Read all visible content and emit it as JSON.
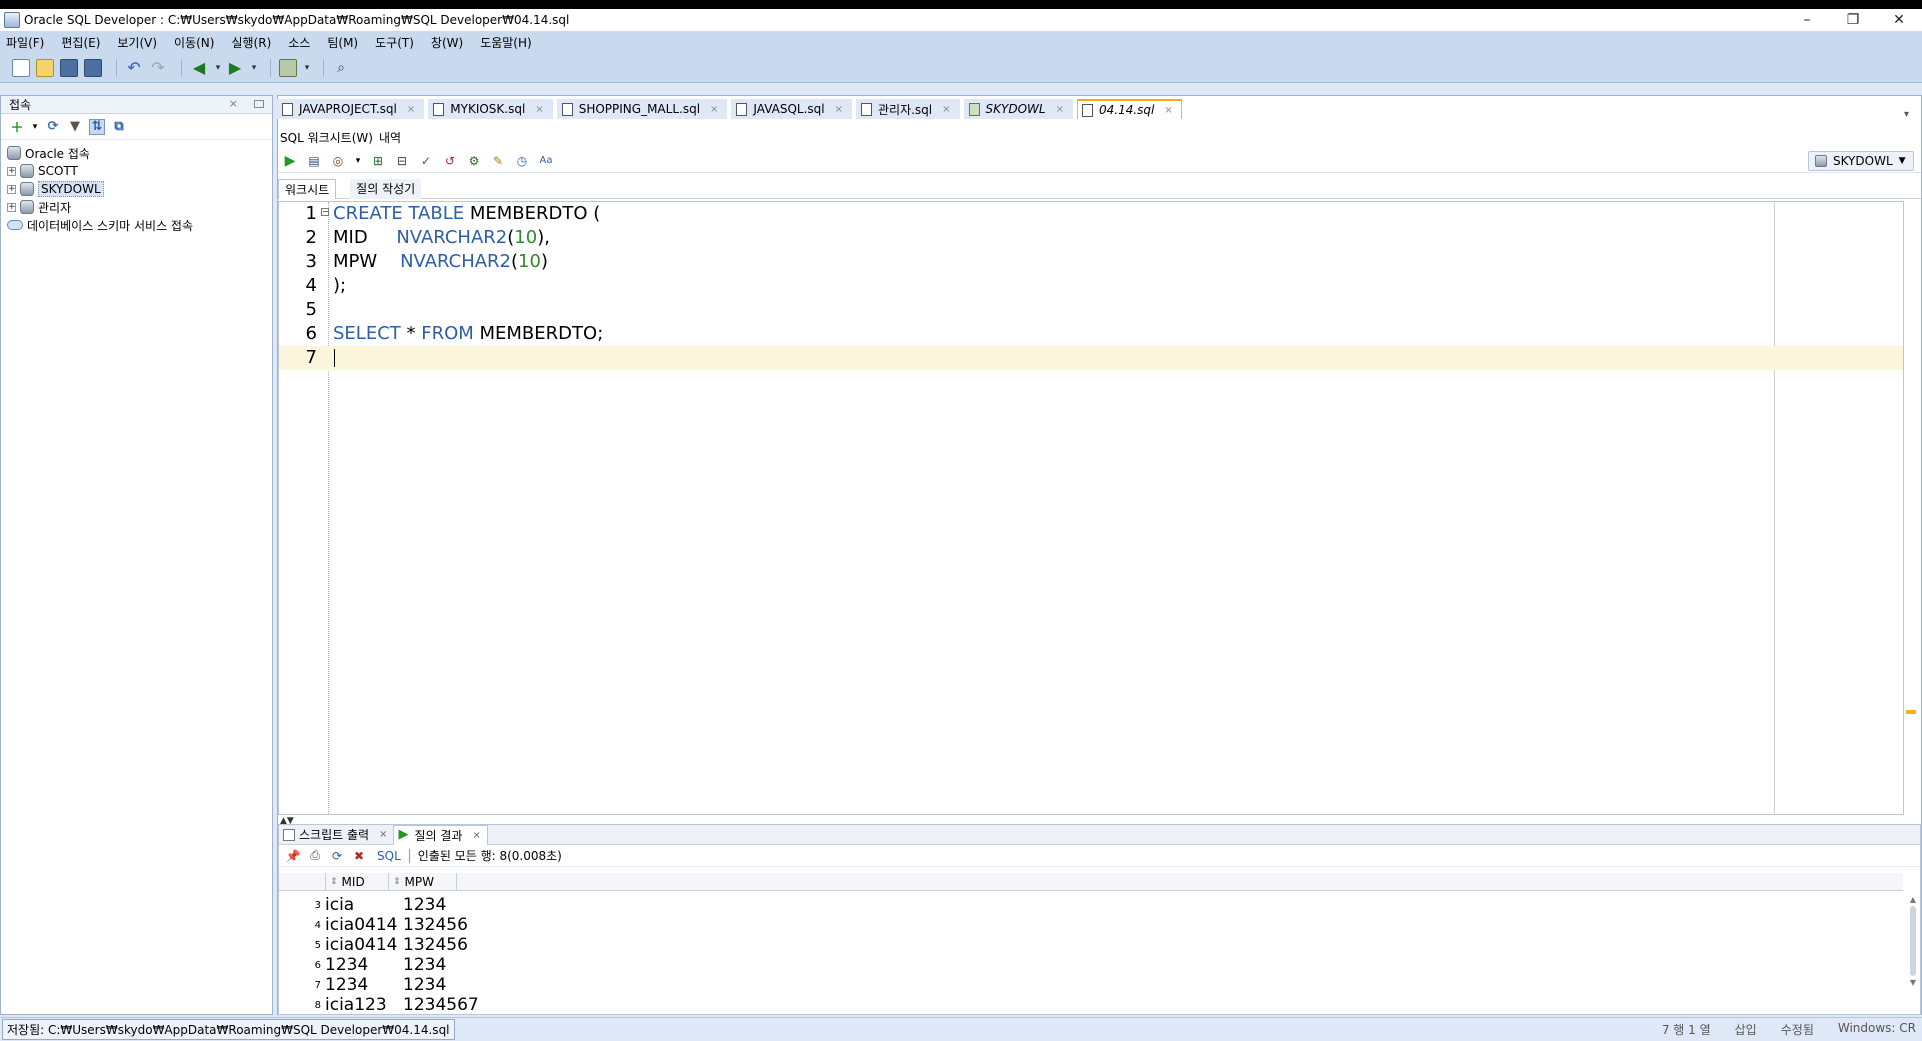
{
  "window": {
    "title": "Oracle SQL Developer : C:₩Users₩skydo₩AppData₩Roaming₩SQL Developer₩04.14.sql",
    "minimize": "–",
    "restore": "❐",
    "close": "✕"
  },
  "menu": [
    "파일(F)",
    "편집(E)",
    "보기(V)",
    "이동(N)",
    "실행(R)",
    "소스",
    "팀(M)",
    "도구(T)",
    "창(W)",
    "도움말(H)"
  ],
  "connections_panel": {
    "title": "접속",
    "close": "×",
    "tree": [
      {
        "label": "Oracle 접속",
        "level": 0,
        "icon": "database-icon"
      },
      {
        "label": "SCOTT",
        "level": 1,
        "icon": "database-icon",
        "expander": "+"
      },
      {
        "label": "SKYDOWL",
        "level": 1,
        "icon": "database-icon",
        "expander": "+",
        "selected": true
      },
      {
        "label": "관리자",
        "level": 1,
        "icon": "database-icon",
        "expander": "+"
      },
      {
        "label": "데이터베이스 스키마 서비스 접속",
        "level": 0,
        "icon": "cloud-icon"
      }
    ]
  },
  "doc_tabs": [
    {
      "label": "JAVAPROJECT.sql",
      "close": "×"
    },
    {
      "label": "MYKIOSK.sql",
      "close": "×"
    },
    {
      "label": "SHOPPING_MALL.sql",
      "close": "×"
    },
    {
      "label": "JAVASQL.sql",
      "close": "×"
    },
    {
      "label": "관리자.sql",
      "close": "×"
    },
    {
      "label": "SKYDOWL",
      "close": "×",
      "italic": true
    },
    {
      "label": "04.14.sql",
      "close": "×",
      "italic": true,
      "active": true
    }
  ],
  "subtabs": {
    "worksheet": "SQL 워크시트(W)",
    "history": "내역"
  },
  "connection_selector": "SKYDOWL",
  "worksheet_tabs": {
    "worksheet": "워크시트",
    "query_builder": "질의 작성기"
  },
  "editor": {
    "lines": [
      {
        "no": "1",
        "text": "CREATE TABLE MEMBERDTO ("
      },
      {
        "no": "2",
        "text": "MID     NVARCHAR2(10),"
      },
      {
        "no": "3",
        "text": "MPW    NVARCHAR2(10)"
      },
      {
        "no": "4",
        "text": ");"
      },
      {
        "no": "5",
        "text": ""
      },
      {
        "no": "6",
        "text": "SELECT * FROM MEMBERDTO;"
      },
      {
        "no": "7",
        "text": ""
      }
    ],
    "current_line": 7
  },
  "results": {
    "tabs": [
      {
        "label": "스크립트 출력",
        "close": "×"
      },
      {
        "label": "질의 결과",
        "close": "×",
        "active": true
      }
    ],
    "sql_link": "SQL",
    "fetched": "인출된 모든 행: 8(0.008초)",
    "columns": [
      "MID",
      "MPW"
    ],
    "rows": [
      {
        "rn": "3",
        "mid": "icia",
        "mpw": "1234"
      },
      {
        "rn": "4",
        "mid": "icia0414",
        "mpw": "132456"
      },
      {
        "rn": "5",
        "mid": "icia0414",
        "mpw": "132456"
      },
      {
        "rn": "6",
        "mid": "1234",
        "mpw": "1234"
      },
      {
        "rn": "7",
        "mid": "1234",
        "mpw": "1234"
      },
      {
        "rn": "8",
        "mid": "icia123",
        "mpw": "1234567"
      }
    ]
  },
  "status": {
    "saved_path": "저장됨: C:₩Users₩skydo₩AppData₩Roaming₩SQL Developer₩04.14.sql",
    "position": "7 행 1 열",
    "insert_mode": "삽입",
    "modified": "수정됨",
    "line_ending": "Windows: CR"
  },
  "colors": {
    "keyword": "#2c5fa8",
    "number": "#2e8b2e",
    "active_tab_accent": "#f5a623",
    "current_line": "#fbf5dc"
  }
}
